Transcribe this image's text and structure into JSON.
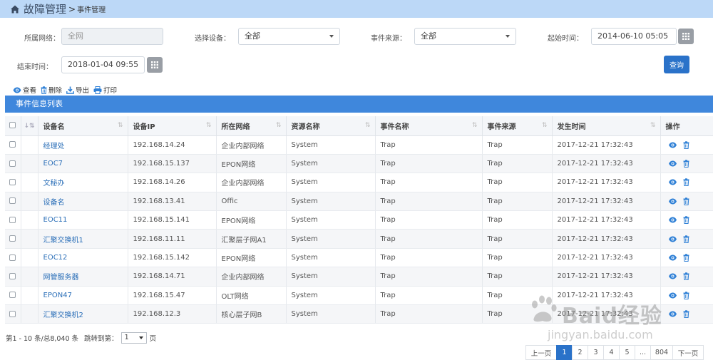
{
  "header": {
    "title": "故障管理",
    "separator": ">",
    "subtitle": "事件管理"
  },
  "filters": {
    "network_label": "所属网络：",
    "network_value": "全网",
    "device_label": "选择设备：",
    "device_value": "全部",
    "source_label": "事件来源：",
    "source_value": "全部",
    "start_label": "起始时间：",
    "start_value": "2014-06-10 05:05",
    "end_label": "结束时间：",
    "end_value": "2018-01-04 09:55",
    "query_label": "查询"
  },
  "toolbar": {
    "view": "查看",
    "delete": "删除",
    "export": "导出",
    "print": "打印"
  },
  "list_title": "事件信息列表",
  "table": {
    "columns": [
      "设备名",
      "设备IP",
      "所在网络",
      "资源名称",
      "事件名称",
      "事件来源",
      "发生时间",
      "操作"
    ],
    "rows": [
      {
        "name": "经理处",
        "ip": "192.168.14.24",
        "network": "企业内部网络",
        "resource": "System",
        "event": "Trap",
        "source": "Trap",
        "time": "2017-12-21 17:32:43"
      },
      {
        "name": "EOC7",
        "ip": "192.168.15.137",
        "network": "EPON网络",
        "resource": "System",
        "event": "Trap",
        "source": "Trap",
        "time": "2017-12-21 17:32:43"
      },
      {
        "name": "文秘办",
        "ip": "192.168.14.26",
        "network": "企业内部网络",
        "resource": "System",
        "event": "Trap",
        "source": "Trap",
        "time": "2017-12-21 17:32:43"
      },
      {
        "name": "设备名",
        "ip": "192.168.13.41",
        "network": "Offic",
        "resource": "System",
        "event": "Trap",
        "source": "Trap",
        "time": "2017-12-21 17:32:43"
      },
      {
        "name": "EOC11",
        "ip": "192.168.15.141",
        "network": "EPON网络",
        "resource": "System",
        "event": "Trap",
        "source": "Trap",
        "time": "2017-12-21 17:32:43"
      },
      {
        "name": "汇聚交换机1",
        "ip": "192.168.11.11",
        "network": "汇聚层子网A1",
        "resource": "System",
        "event": "Trap",
        "source": "Trap",
        "time": "2017-12-21 17:32:43"
      },
      {
        "name": "EOC12",
        "ip": "192.168.15.142",
        "network": "EPON网络",
        "resource": "System",
        "event": "Trap",
        "source": "Trap",
        "time": "2017-12-21 17:32:43"
      },
      {
        "name": "网管服务器",
        "ip": "192.168.14.71",
        "network": "企业内部网络",
        "resource": "System",
        "event": "Trap",
        "source": "Trap",
        "time": "2017-12-21 17:32:43"
      },
      {
        "name": "EPON47",
        "ip": "192.168.15.47",
        "network": "OLT网络",
        "resource": "System",
        "event": "Trap",
        "source": "Trap",
        "time": "2017-12-21 17:32:43"
      },
      {
        "name": "汇聚交换机2",
        "ip": "192.168.12.3",
        "network": "核心层子网B",
        "resource": "System",
        "event": "Trap",
        "source": "Trap",
        "time": "2017-12-21 17:32:43"
      }
    ]
  },
  "pagination": {
    "summary": "第1 - 10 条/总8,040 条",
    "jump_label": "跳转到第：",
    "jump_value": "1",
    "page_suffix": "页",
    "prev": "上一页",
    "pages": [
      "1",
      "2",
      "3",
      "4",
      "5",
      "...",
      "804"
    ],
    "next": "下一页"
  },
  "watermark": {
    "line1": "Baid经验",
    "line2": "jingyan.baidu.com"
  },
  "colors": {
    "topbar": "#bcd8f7",
    "list_header": "#3f87dc",
    "primary_button": "#2a72c9",
    "link": "#2b6fb8",
    "icon_blue": "#2f80d6"
  },
  "icons": {
    "home": "home-icon",
    "calendar": "calendar-grid-icon",
    "view": "eye-icon",
    "delete": "trash-icon",
    "export": "download-icon",
    "print": "printer-icon",
    "sort": "sort-icon"
  }
}
